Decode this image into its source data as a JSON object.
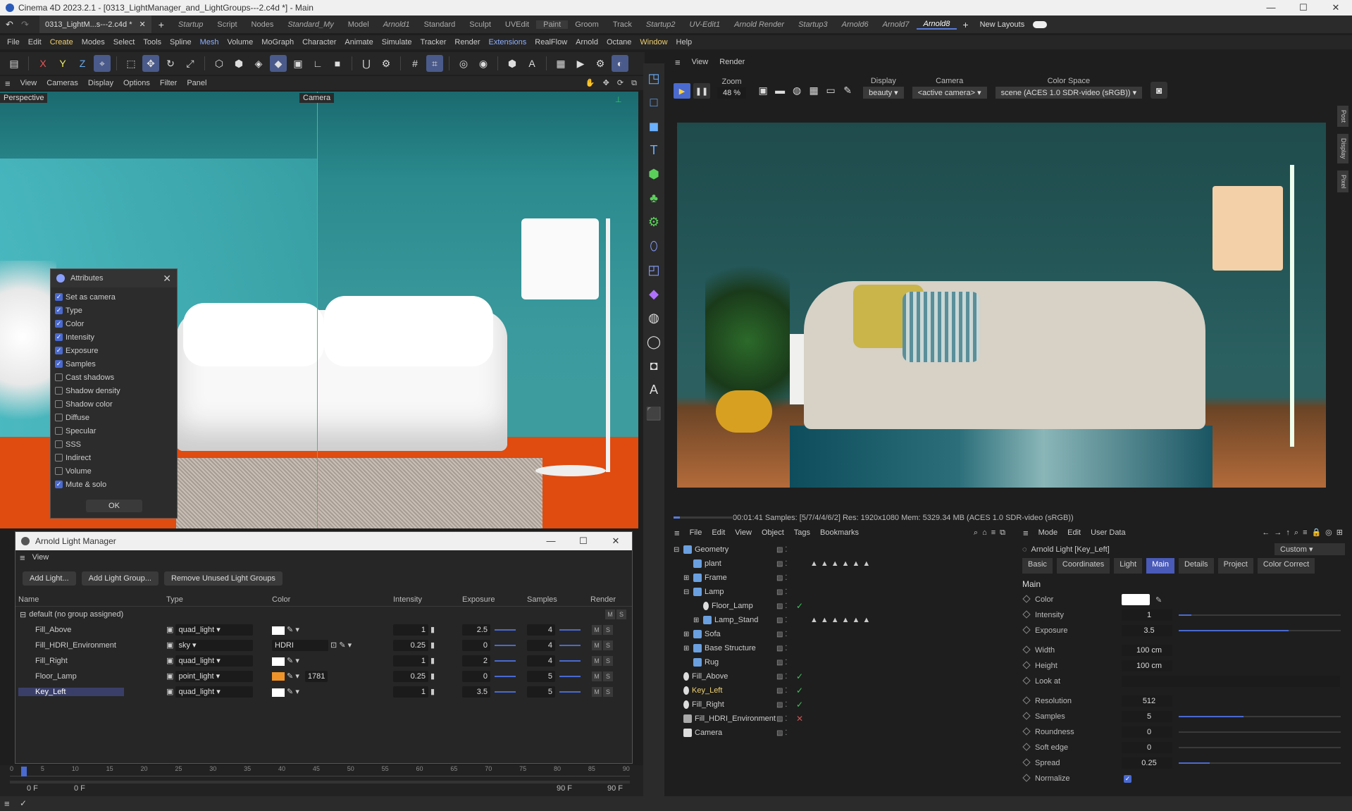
{
  "window": {
    "title": "Cinema 4D 2023.2.1 - [0313_LightManager_and_LightGroups---2.c4d *] - Main",
    "doc_tab": "0313_LightM...s---2.c4d *"
  },
  "layout_tabs": [
    {
      "label": "Startup",
      "italic": true
    },
    {
      "label": "Script"
    },
    {
      "label": "Nodes"
    },
    {
      "label": "Standard_My",
      "italic": true
    },
    {
      "label": "Model"
    },
    {
      "label": "Arnold1",
      "italic": true
    },
    {
      "label": "Standard"
    },
    {
      "label": "Sculpt"
    },
    {
      "label": "UVEdit"
    },
    {
      "label": "Paint"
    },
    {
      "label": "Groom"
    },
    {
      "label": "Track"
    },
    {
      "label": "Startup2",
      "italic": true
    },
    {
      "label": "UV-Edit1",
      "italic": true
    },
    {
      "label": "Arnold Render",
      "italic": true
    },
    {
      "label": "Startup3",
      "italic": true
    },
    {
      "label": "Arnold6",
      "italic": true
    },
    {
      "label": "Arnold7",
      "italic": true
    },
    {
      "label": "Arnold8",
      "italic": true,
      "active": true
    }
  ],
  "new_layouts_label": "New Layouts",
  "menu": [
    "File",
    "Edit",
    "Create",
    "Modes",
    "Select",
    "Tools",
    "Spline",
    "Mesh",
    "Volume",
    "MoGraph",
    "Character",
    "Animate",
    "Simulate",
    "Tracker",
    "Render",
    "Extensions",
    "RealFlow",
    "Arnold",
    "Octane",
    "Window",
    "Help"
  ],
  "viewport_menu": [
    "View",
    "Cameras",
    "Display",
    "Options",
    "Filter",
    "Panel"
  ],
  "viewport": {
    "name": "Perspective",
    "camera": "Camera"
  },
  "attributes_popup": {
    "title": "Attributes",
    "items": [
      {
        "label": "Set as camera",
        "checked": true
      },
      {
        "label": "Type",
        "checked": true
      },
      {
        "label": "Color",
        "checked": true
      },
      {
        "label": "Intensity",
        "checked": true
      },
      {
        "label": "Exposure",
        "checked": true
      },
      {
        "label": "Samples",
        "checked": true
      },
      {
        "label": "Cast shadows",
        "checked": false
      },
      {
        "label": "Shadow density",
        "checked": false
      },
      {
        "label": "Shadow color",
        "checked": false
      },
      {
        "label": "Diffuse",
        "checked": false
      },
      {
        "label": "Specular",
        "checked": false
      },
      {
        "label": "SSS",
        "checked": false
      },
      {
        "label": "Indirect",
        "checked": false
      },
      {
        "label": "Volume",
        "checked": false
      },
      {
        "label": "Mute & solo",
        "checked": true
      }
    ],
    "ok": "OK"
  },
  "light_manager": {
    "title": "Arnold Light Manager",
    "view": "View",
    "buttons": [
      "Add Light...",
      "Add Light Group...",
      "Remove Unused Light Groups"
    ],
    "columns": [
      "Name",
      "Type",
      "Color",
      "Intensity",
      "Exposure",
      "Samples",
      "Render"
    ],
    "group": "default (no group assigned)",
    "rows": [
      {
        "name": "Fill_Above",
        "type": "quad_light",
        "color": "#ffffff",
        "intensity": "1",
        "exposure": "2.5",
        "samples": "4"
      },
      {
        "name": "Fill_HDRI_Environment",
        "type": "sky",
        "color_text": "HDRI",
        "intensity": "0.25",
        "exposure": "0",
        "samples": "4"
      },
      {
        "name": "Fill_Right",
        "type": "quad_light",
        "color": "#ffffff",
        "intensity": "1",
        "exposure": "2",
        "samples": "4"
      },
      {
        "name": "Floor_Lamp",
        "type": "point_light",
        "color": "#f0942a",
        "temp": "1781",
        "intensity": "0.25",
        "exposure": "0",
        "samples": "5"
      },
      {
        "name": "Key_Left",
        "type": "quad_light",
        "color": "#ffffff",
        "intensity": "1",
        "exposure": "3.5",
        "samples": "5",
        "selected": true
      }
    ],
    "render_m": "M",
    "render_s": "S"
  },
  "timeline": {
    "start": "0 F",
    "current": "0 F",
    "end_a": "90 F",
    "end_b": "90 F",
    "ticks": [
      "0",
      "5",
      "10",
      "15",
      "20",
      "25",
      "30",
      "35",
      "40",
      "45",
      "50",
      "55",
      "60",
      "65",
      "70",
      "75",
      "80",
      "85",
      "90"
    ]
  },
  "render_view": {
    "menu": [
      "View",
      "Render"
    ],
    "zoom_label": "Zoom",
    "zoom": "48 %",
    "display_label": "Display",
    "display": "beauty",
    "camera_label": "Camera",
    "camera": "<active camera>",
    "colorspace_label": "Color Space",
    "colorspace": "scene (ACES 1.0 SDR-video (sRGB))",
    "side_tabs": [
      "Post",
      "Display",
      "Pixel"
    ],
    "status": "00:01:41  Samples: [5/7/4/4/6/2]  Res: 1920x1080  Mem: 5329.34 MB  (ACES 1.0 SDR-video (sRGB))",
    "progress": 0.1
  },
  "object_manager": {
    "menu": [
      "File",
      "Edit",
      "View",
      "Object",
      "Tags",
      "Bookmarks"
    ],
    "objects": [
      {
        "name": "Geometry",
        "indent": 0,
        "icon": "null-icon",
        "expand": "-"
      },
      {
        "name": "plant",
        "indent": 1,
        "icon": "mesh-icon",
        "tags": "▲▲▲▲▲▲"
      },
      {
        "name": "Frame",
        "indent": 1,
        "icon": "null-icon",
        "expand": "+"
      },
      {
        "name": "Lamp",
        "indent": 1,
        "icon": "null-icon",
        "expand": "-"
      },
      {
        "name": "Floor_Lamp",
        "indent": 2,
        "icon": "light-icon",
        "check": true
      },
      {
        "name": "Lamp_Stand",
        "indent": 2,
        "icon": "mesh-icon",
        "expand": "+",
        "tags": "▲▲▲▲▲▲"
      },
      {
        "name": "Sofa",
        "indent": 1,
        "icon": "null-icon",
        "expand": "+"
      },
      {
        "name": "Base Structure",
        "indent": 1,
        "icon": "null-icon",
        "expand": "+"
      },
      {
        "name": "Rug",
        "indent": 1,
        "icon": "mesh-icon"
      },
      {
        "name": "Fill_Above",
        "indent": 0,
        "icon": "light-icon",
        "check": true
      },
      {
        "name": "Key_Left",
        "indent": 0,
        "icon": "light-icon",
        "check": true,
        "selected": true
      },
      {
        "name": "Fill_Right",
        "indent": 0,
        "icon": "light-icon",
        "check": true
      },
      {
        "name": "Fill_HDRI_Environment",
        "indent": 0,
        "icon": "sky-icon",
        "cross": true
      },
      {
        "name": "Camera",
        "indent": 0,
        "icon": "camera-icon"
      }
    ]
  },
  "attribute_manager": {
    "menu": [
      "Mode",
      "Edit",
      "User Data"
    ],
    "object": "Arnold Light [Key_Left]",
    "mode": "Custom",
    "tabs": [
      "Basic",
      "Coordinates",
      "Light",
      "Main",
      "Details",
      "Project",
      "Color Correct"
    ],
    "active_tab": "Main",
    "section": "Main",
    "fields": [
      {
        "label": "Color",
        "type": "color"
      },
      {
        "label": "Intensity",
        "value": "1",
        "slider": 0.08
      },
      {
        "label": "Exposure",
        "value": "3.5",
        "slider": 0.68
      },
      {
        "label": "Width",
        "value": "100 cm"
      },
      {
        "label": "Height",
        "value": "100 cm"
      },
      {
        "label": "Look at",
        "value": ""
      },
      {
        "label": "Resolution",
        "value": "512"
      },
      {
        "label": "Samples",
        "value": "5",
        "slider": 0.4
      },
      {
        "label": "Roundness",
        "value": "0",
        "slider": 0.0
      },
      {
        "label": "Soft edge",
        "value": "0",
        "slider": 0.0
      },
      {
        "label": "Spread",
        "value": "0.25",
        "slider": 0.19
      },
      {
        "label": "Normalize",
        "type": "check",
        "checked": true
      }
    ]
  },
  "colors": {
    "accent": "#4a6ad0",
    "selected_text": "#f0d070",
    "active_check": "#3ec65a"
  }
}
